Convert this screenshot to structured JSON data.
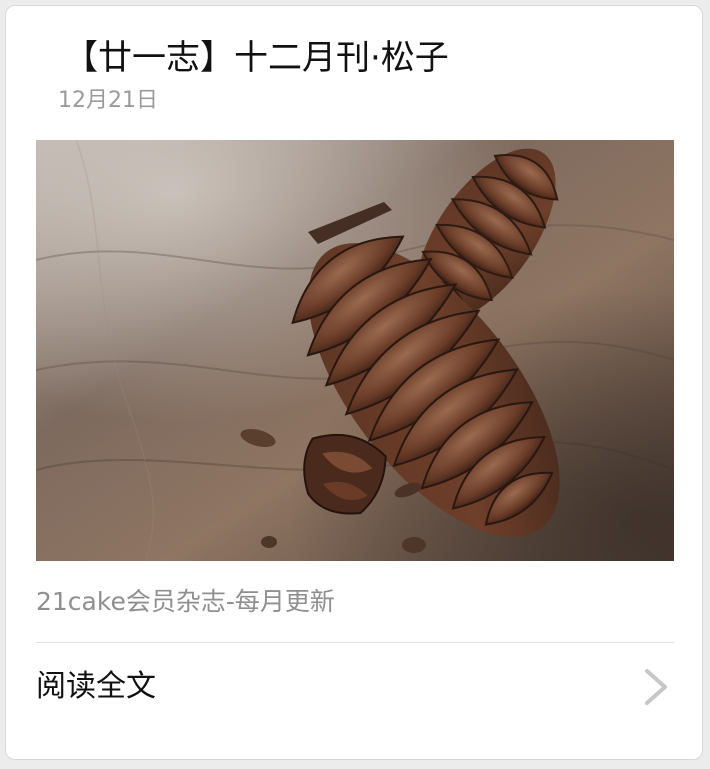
{
  "article": {
    "title": "【廿一志】十二月刊·松子",
    "date": "12月21日",
    "cover_alt": "pine cones on weathered wood",
    "description": "21cake会员杂志-每月更新",
    "read_more_label": "阅读全文"
  },
  "icons": {
    "read_more": "chevron-right-icon"
  },
  "colors": {
    "title": "#111111",
    "date": "#9a9a9a",
    "description": "#8f8f8f",
    "chevron": "#c7c7c7",
    "divider": "#e3e3e3",
    "card_background": "#ffffff",
    "page_background": "#ececec"
  }
}
